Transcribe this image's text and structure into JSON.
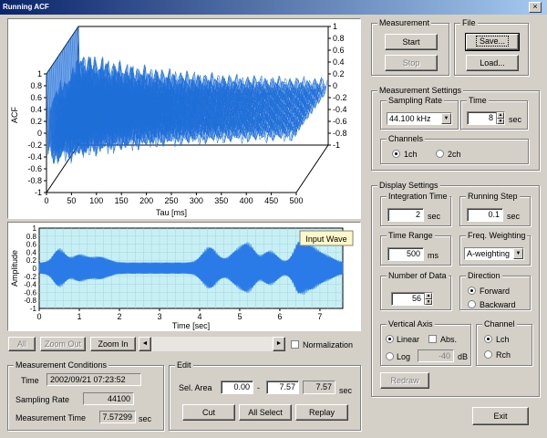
{
  "window": {
    "title": "Running ACF"
  },
  "acf_chart": {
    "ylabel": "ACF",
    "xlabel": "Tau [ms]",
    "x_ticks": [
      "0",
      "50",
      "100",
      "150",
      "200",
      "250",
      "300",
      "350",
      "400",
      "450",
      "500"
    ],
    "y_left_ticks": [
      "1",
      "0.8",
      "0.6",
      "0.4",
      "0.2",
      "0",
      "-0.2",
      "-0.4",
      "-0.6",
      "-0.8",
      "-1"
    ],
    "y_right_ticks": [
      "1",
      "0.8",
      "0.6",
      "0.4",
      "0.2",
      "0",
      "-0.2",
      "-0.4",
      "-0.6",
      "-0.8",
      "-1"
    ],
    "line_color": "#1f6fd8"
  },
  "wave_chart": {
    "ylabel": "Amplitude",
    "xlabel": "Time [sec]",
    "x_ticks": [
      "0",
      "1",
      "2",
      "3",
      "4",
      "5",
      "6",
      "7"
    ],
    "y_ticks": [
      "1",
      "0.8",
      "0.6",
      "0.4",
      "0.2",
      "0",
      "-0.2",
      "-0.4",
      "-0.6",
      "-0.8",
      "-1"
    ],
    "legend": "Input Wave",
    "bg_color": "#c8f0f4",
    "wave_color": "#2a7be8"
  },
  "chart_data": [
    {
      "type": "line",
      "title": "",
      "xlabel": "Tau [ms]",
      "ylabel": "ACF",
      "xlim": [
        0,
        500
      ],
      "ylim": [
        -1,
        1
      ],
      "note_series": "waterfall of running autocorrelation functions"
    },
    {
      "type": "line",
      "title": "",
      "xlabel": "Time [sec]",
      "ylabel": "Amplitude",
      "xlim": [
        0,
        7.57
      ],
      "ylim": [
        -1,
        1
      ],
      "series": [
        {
          "name": "Input Wave"
        }
      ]
    }
  ],
  "zoom_toolbar": {
    "all": "All",
    "zoom_out": "Zoom Out",
    "zoom_in": "Zoom In",
    "normalization": "Normalization",
    "scroll_left": "◄",
    "scroll_right": "►"
  },
  "measurement": {
    "label": "Measurement",
    "start": "Start",
    "stop": "Stop"
  },
  "file": {
    "label": "File",
    "save": "Save...",
    "load": "Load..."
  },
  "measurement_settings": {
    "label": "Measurement Settings",
    "sampling_rate_label": "Sampling Rate",
    "sampling_rate_value": "44.100 kHz",
    "time_label": "Time",
    "time_value": "8",
    "time_unit": "sec",
    "channels_label": "Channels",
    "ch1": "1ch",
    "ch2": "2ch"
  },
  "display_settings": {
    "label": "Display Settings",
    "integration_time_label": "Integration Time",
    "integration_time_value": "2",
    "integration_time_unit": "sec",
    "running_step_label": "Running Step",
    "running_step_value": "0.1",
    "running_step_unit": "sec",
    "time_range_label": "Time Range",
    "time_range_value": "500",
    "time_range_unit": "ms",
    "freq_weighting_label": "Freq. Weighting",
    "freq_weighting_value": "A-weighting",
    "number_of_data_label": "Number of Data",
    "number_of_data_value": "56",
    "direction_label": "Direction",
    "forward": "Forward",
    "backward": "Backward",
    "vertical_axis_label": "Vertical Axis",
    "linear": "Linear",
    "abs": "Abs.",
    "log": "Log",
    "log_value": "-40",
    "db_unit": "dB",
    "channel_label": "Channel",
    "lch": "Lch",
    "rch": "Rch",
    "redraw": "Redraw"
  },
  "measurement_conditions": {
    "label": "Measurement Conditions",
    "time_label": "Time",
    "time_value": "2002/09/21 07:23:52",
    "sampling_rate_label": "Sampling Rate",
    "sampling_rate_value": "44100",
    "measurement_time_label": "Measurement Time",
    "measurement_time_value": "7.57299",
    "measurement_time_unit": "sec"
  },
  "edit": {
    "label": "Edit",
    "sel_area_label": "Sel. Area",
    "sel_from": "0.00",
    "dash": "-",
    "sel_to": "7.57",
    "sel_len": "7.57",
    "sec_unit": "sec",
    "cut": "Cut",
    "all_select": "All Select",
    "replay": "Replay"
  },
  "exit": "Exit"
}
